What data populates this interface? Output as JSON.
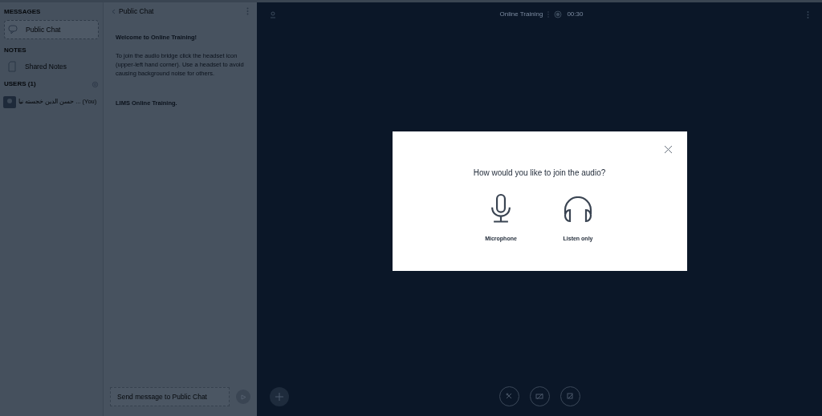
{
  "sidebar": {
    "messages_heading": "MESSAGES",
    "messages": [
      {
        "label": "Public Chat",
        "selected": true
      }
    ],
    "notes_heading": "NOTES",
    "notes": [
      {
        "label": "Shared Notes"
      }
    ],
    "users_heading": "USERS (1)",
    "users": [
      {
        "name": "... حسن الدین خجسته نیا",
        "suffix": "(You)"
      }
    ]
  },
  "chat": {
    "title": "Public Chat",
    "messages": [
      {
        "text": "Welcome to Online Training!",
        "bold": true
      },
      {
        "text": "To join the audio bridge click the headset icon (upper-left hand corner). Use a headset to avoid causing background noise for others.",
        "bold": false
      },
      {
        "text": "LIMS Online Training.",
        "bold": true
      }
    ],
    "input": {
      "placeholder": "Send message to Public Chat"
    }
  },
  "main": {
    "title": "Online Training",
    "timer": "00:30"
  },
  "modal": {
    "title": "How would you like to join the audio?",
    "options": [
      {
        "kind": "microphone",
        "label": "Microphone"
      },
      {
        "kind": "headphones",
        "label": "Listen only"
      }
    ]
  }
}
